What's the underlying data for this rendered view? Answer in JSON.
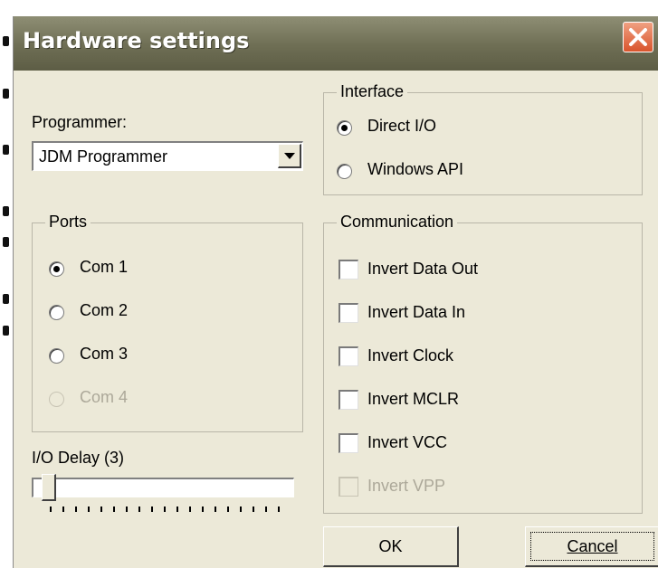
{
  "window": {
    "title": "Hardware settings",
    "close_icon": "close-icon"
  },
  "programmer": {
    "label": "Programmer:",
    "selected": "JDM Programmer"
  },
  "interface": {
    "label": "Interface",
    "options": [
      {
        "label": "Direct I/O",
        "checked": true
      },
      {
        "label": "Windows API",
        "checked": false
      }
    ]
  },
  "ports": {
    "label": "Ports",
    "options": [
      {
        "label": "Com 1",
        "checked": true
      },
      {
        "label": "Com 2",
        "checked": false
      },
      {
        "label": "Com 3",
        "checked": false
      },
      {
        "label": "Com 4",
        "checked": false,
        "disabled": true
      }
    ]
  },
  "communication": {
    "label": "Communication",
    "options": [
      {
        "label": "Invert Data Out",
        "checked": false
      },
      {
        "label": "Invert Data In",
        "checked": false
      },
      {
        "label": "Invert Clock",
        "checked": false
      },
      {
        "label": "Invert MCLR",
        "checked": false
      },
      {
        "label": "Invert VCC",
        "checked": false
      },
      {
        "label": "Invert VPP",
        "checked": false,
        "disabled": true
      }
    ]
  },
  "io_delay": {
    "label": "I/O Delay (3)",
    "value": 3
  },
  "buttons": {
    "ok": "OK",
    "cancel": "Cancel"
  }
}
